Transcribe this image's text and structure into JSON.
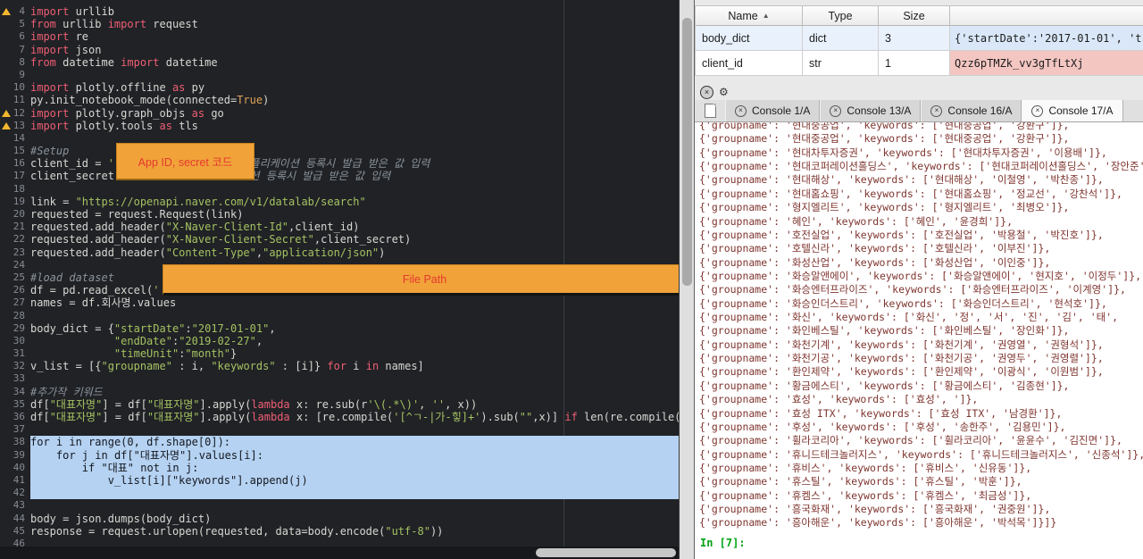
{
  "editor": {
    "annotations": [
      {
        "label": "App ID, secret 코드"
      },
      {
        "label": "File Path"
      }
    ],
    "lines": [
      {
        "n": 4,
        "warn": true,
        "toks": [
          [
            "kw",
            "import"
          ],
          [
            "def",
            " urllib"
          ]
        ]
      },
      {
        "n": 5,
        "toks": [
          [
            "kw",
            "from"
          ],
          [
            "def",
            " urllib "
          ],
          [
            "kw",
            "import"
          ],
          [
            "def",
            " request"
          ]
        ]
      },
      {
        "n": 6,
        "toks": [
          [
            "kw",
            "import"
          ],
          [
            "def",
            " re"
          ]
        ]
      },
      {
        "n": 7,
        "toks": [
          [
            "kw",
            "import"
          ],
          [
            "def",
            " json"
          ]
        ]
      },
      {
        "n": 8,
        "toks": [
          [
            "kw",
            "from"
          ],
          [
            "def",
            " datetime "
          ],
          [
            "kw",
            "import"
          ],
          [
            "def",
            " datetime"
          ]
        ]
      },
      {
        "n": 9,
        "toks": []
      },
      {
        "n": 10,
        "toks": [
          [
            "kw",
            "import"
          ],
          [
            "def",
            " plotly.offline "
          ],
          [
            "kw",
            "as"
          ],
          [
            "def",
            " py"
          ]
        ]
      },
      {
        "n": 11,
        "toks": [
          [
            "def",
            "py.init_notebook_mode(connected="
          ],
          [
            "num",
            "True"
          ],
          [
            "def",
            ")"
          ]
        ]
      },
      {
        "n": 12,
        "warn": true,
        "toks": [
          [
            "kw",
            "import"
          ],
          [
            "def",
            " plotly.graph_objs "
          ],
          [
            "kw",
            "as"
          ],
          [
            "def",
            " go"
          ]
        ]
      },
      {
        "n": 13,
        "warn": true,
        "toks": [
          [
            "kw",
            "import"
          ],
          [
            "def",
            " plotly.tools "
          ],
          [
            "kw",
            "as"
          ],
          [
            "def",
            " tls"
          ]
        ]
      },
      {
        "n": 14,
        "toks": []
      },
      {
        "n": 15,
        "toks": [
          [
            "com",
            "#Setup"
          ]
        ]
      },
      {
        "n": 16,
        "toks": [
          [
            "def",
            "client_id = "
          ],
          [
            "str",
            "'"
          ],
          [
            "def",
            "                     "
          ],
          [
            "com",
            "플리케이션 등록시 발급 받은 값 입력"
          ]
        ]
      },
      {
        "n": 17,
        "toks": [
          [
            "def",
            "client_secret"
          ],
          [
            "def",
            "                     "
          ],
          [
            "com",
            "션 등록시 발급 받은 값 입력"
          ]
        ]
      },
      {
        "n": 18,
        "toks": []
      },
      {
        "n": 19,
        "toks": [
          [
            "def",
            "link = "
          ],
          [
            "str",
            "\"https://openapi.naver.com/v1/datalab/search\""
          ]
        ]
      },
      {
        "n": 20,
        "toks": [
          [
            "def",
            "requested = request.Request(link)"
          ]
        ]
      },
      {
        "n": 21,
        "toks": [
          [
            "def",
            "requested.add_header("
          ],
          [
            "str",
            "\"X-Naver-Client-Id\""
          ],
          [
            "def",
            ",client_id)"
          ]
        ]
      },
      {
        "n": 22,
        "toks": [
          [
            "def",
            "requested.add_header("
          ],
          [
            "str",
            "\"X-Naver-Client-Secret\""
          ],
          [
            "def",
            ",client_secret)"
          ]
        ]
      },
      {
        "n": 23,
        "toks": [
          [
            "def",
            "requested.add_header("
          ],
          [
            "str",
            "\"Content-Type\""
          ],
          [
            "def",
            ","
          ],
          [
            "str",
            "\"application/json\""
          ],
          [
            "def",
            ")"
          ]
        ]
      },
      {
        "n": 24,
        "toks": []
      },
      {
        "n": 25,
        "toks": [
          [
            "com",
            "#load dataset"
          ]
        ]
      },
      {
        "n": 26,
        "toks": [
          [
            "def",
            "df = pd.read_excel("
          ],
          [
            "str",
            "'"
          ]
        ]
      },
      {
        "n": 27,
        "toks": [
          [
            "def",
            "names = df.회사명.values"
          ]
        ]
      },
      {
        "n": 28,
        "toks": []
      },
      {
        "n": 29,
        "toks": [
          [
            "def",
            "body_dict = {"
          ],
          [
            "str",
            "\"startDate\""
          ],
          [
            "def",
            ":"
          ],
          [
            "str",
            "\"2017-01-01\""
          ],
          [
            "def",
            ","
          ]
        ]
      },
      {
        "n": 30,
        "toks": [
          [
            "def",
            "             "
          ],
          [
            "str",
            "\"endDate\""
          ],
          [
            "def",
            ":"
          ],
          [
            "str",
            "\"2019-02-27\""
          ],
          [
            "def",
            ","
          ]
        ]
      },
      {
        "n": 31,
        "toks": [
          [
            "def",
            "             "
          ],
          [
            "str",
            "\"timeUnit\""
          ],
          [
            "def",
            ":"
          ],
          [
            "str",
            "\"month\""
          ],
          [
            "def",
            "}"
          ]
        ]
      },
      {
        "n": 32,
        "toks": [
          [
            "def",
            "v_list = [{"
          ],
          [
            "str",
            "\"groupname\""
          ],
          [
            "def",
            " : i, "
          ],
          [
            "str",
            "\"keywords\""
          ],
          [
            "def",
            " : [i]} "
          ],
          [
            "kw",
            "for"
          ],
          [
            "def",
            " i "
          ],
          [
            "kw",
            "in"
          ],
          [
            "def",
            " names]"
          ]
        ]
      },
      {
        "n": 33,
        "toks": []
      },
      {
        "n": 34,
        "toks": [
          [
            "com",
            "#추가작 키워드"
          ]
        ]
      },
      {
        "n": 35,
        "toks": [
          [
            "def",
            "df["
          ],
          [
            "str",
            "\"대표자명\""
          ],
          [
            "def",
            "] = df["
          ],
          [
            "str",
            "\"대표자명\""
          ],
          [
            "def",
            "].apply("
          ],
          [
            "kw",
            "lambda"
          ],
          [
            "def",
            " x: re.sub(r"
          ],
          [
            "str",
            "'\\(.*\\)'"
          ],
          [
            "def",
            ", "
          ],
          [
            "str",
            "''"
          ],
          [
            "def",
            ", x))"
          ]
        ]
      },
      {
        "n": 36,
        "toks": [
          [
            "def",
            "df["
          ],
          [
            "str",
            "\"대표자명\""
          ],
          [
            "def",
            "] = df["
          ],
          [
            "str",
            "\"대표자명\""
          ],
          [
            "def",
            "].apply("
          ],
          [
            "kw",
            "lambda"
          ],
          [
            "def",
            " x: [re.compile("
          ],
          [
            "str",
            "'[^ㄱ-|가-힣]+'"
          ],
          [
            "def",
            ").sub("
          ],
          [
            "str",
            "\"\""
          ],
          [
            "def",
            ",x)] "
          ],
          [
            "kw",
            "if"
          ],
          [
            "def",
            " len(re.compile("
          ]
        ]
      },
      {
        "n": 37,
        "toks": []
      },
      {
        "n": 38,
        "sel": true,
        "toks": [
          [
            "kw",
            "for"
          ],
          [
            "def",
            " i "
          ],
          [
            "kw",
            "in"
          ],
          [
            "def",
            " range("
          ],
          [
            "num",
            "0"
          ],
          [
            "def",
            ", df.shape["
          ],
          [
            "num",
            "0"
          ],
          [
            "def",
            "]):"
          ]
        ]
      },
      {
        "n": 39,
        "sel": true,
        "toks": [
          [
            "def",
            "    "
          ],
          [
            "kw",
            "for"
          ],
          [
            "def",
            " j "
          ],
          [
            "kw",
            "in"
          ],
          [
            "def",
            " df["
          ],
          [
            "str",
            "\"대표자명\""
          ],
          [
            "def",
            "].values[i]:"
          ]
        ]
      },
      {
        "n": 40,
        "sel": true,
        "toks": [
          [
            "def",
            "        "
          ],
          [
            "kw",
            "if"
          ],
          [
            "def",
            " "
          ],
          [
            "str",
            "\"대표\""
          ],
          [
            "def",
            " "
          ],
          [
            "kw",
            "not"
          ],
          [
            "def",
            " "
          ],
          [
            "kw",
            "in"
          ],
          [
            "def",
            " j:"
          ]
        ]
      },
      {
        "n": 41,
        "sel": true,
        "toks": [
          [
            "def",
            "            v_list[i]["
          ],
          [
            "str",
            "\"keywords\""
          ],
          [
            "def",
            "].append(j)"
          ]
        ]
      },
      {
        "n": 42,
        "sel": true,
        "toks": []
      },
      {
        "n": 43,
        "toks": []
      },
      {
        "n": 44,
        "toks": [
          [
            "def",
            "body = json.dumps(body_dict)"
          ]
        ]
      },
      {
        "n": 45,
        "toks": [
          [
            "def",
            "response = request.urlopen(requested, data=body.encode("
          ],
          [
            "str",
            "\"utf-8\""
          ],
          [
            "def",
            "))"
          ]
        ]
      },
      {
        "n": 46,
        "toks": []
      }
    ]
  },
  "variable_explorer": {
    "columns": [
      {
        "label": "Name"
      },
      {
        "label": "Type"
      },
      {
        "label": "Size"
      }
    ],
    "sort_glyph": "▲",
    "rows": [
      {
        "name": "body_dict",
        "type": "dict",
        "size": "3",
        "value": "{'startDate':'2017-01-01', 't",
        "kind": "dict",
        "selected": true
      },
      {
        "name": "client_id",
        "type": "str",
        "size": "1",
        "value": "Qzz6pTMZk_vv3gTfLtXj",
        "kind": "str",
        "selected": false
      }
    ]
  },
  "console": {
    "controls": [
      {
        "name": "close",
        "glyph": "×"
      },
      {
        "name": "options",
        "glyph": "⚙"
      }
    ],
    "close_glyph": "×",
    "tabs": [
      {
        "label": "Console 1/A",
        "active": false
      },
      {
        "label": "Console 13/A",
        "active": false
      },
      {
        "label": "Console 16/A",
        "active": false
      },
      {
        "label": "Console 17/A",
        "active": true
      }
    ],
    "output_lines": [
      "{'groupname': '현대중공업', 'keywords': ['현대중공업', '강환구']},",
      "{'groupname': '현대중공업', 'keywords': ['현대중공업', '강환구']},",
      "{'groupname': '현대차투자증권', 'keywords': ['현대차투자증권', '이용배']},",
      "{'groupname': '현대코퍼레이션홀딩스', 'keywords': ['현대코퍼레이션홀딩스', '장안준']},",
      "{'groupname': '현대해상', 'keywords': ['현대해상', '이철영', '박찬종']},",
      "{'groupname': '현대홈쇼핑', 'keywords': ['현대홈쇼핑', '정교선', '강찬석']},",
      "{'groupname': '형지엘리트', 'keywords': ['형지엘리트', '최병오']},",
      "{'groupname': '혜인', 'keywords': ['혜인', '윤경희']},",
      "{'groupname': '호전실업', 'keywords': ['호전실업', '박용철', '박진호']},",
      "{'groupname': '호텔신라', 'keywords': ['호텔신라', '이부진']},",
      "{'groupname': '화성산업', 'keywords': ['화성산업', '이인중']},",
      "{'groupname': '화승알앤에이', 'keywords': ['화승알앤에이', '현지호', '이정두']},",
      "{'groupname': '화승엔터프라이즈', 'keywords': ['화승엔터프라이즈', '이계영']},",
      "{'groupname': '화승인더스트리', 'keywords': ['화승인더스트리', '현석호']},",
      "{'groupname': '화신', 'keywords': ['화신', '정', '서', '진', '김', '태',",
      "{'groupname': '화인베스틸', 'keywords': ['화인베스틸', '장인화']},",
      "{'groupname': '화천기계', 'keywords': ['화천기계', '권영열', '권형석']},",
      "{'groupname': '화천기공', 'keywords': ['화천기공', '권영두', '권영렬']},",
      "{'groupname': '환인제약', 'keywords': ['환인제약', '이광식', '이원범']},",
      "{'groupname': '황금에스티', 'keywords': ['황금에스티', '김종현']},",
      "{'groupname': '효성', 'keywords': ['효성', ']},",
      "{'groupname': '효성 ITX', 'keywords': ['효성 ITX', '남경환']},",
      "{'groupname': '후성', 'keywords': ['후성', '송한주', '김용민']},",
      "{'groupname': '휠라코리아', 'keywords': ['휠라코리아', '윤윤수', '김진면']},",
      "{'groupname': '휴니드테크놀러지스', 'keywords': ['휴니드테크놀러지스', '신종석']},",
      "{'groupname': '휴비스', 'keywords': ['휴비스', '신유동']},",
      "{'groupname': '휴스틸', 'keywords': ['휴스틸', '박훈']},",
      "{'groupname': '휴켐스', 'keywords': ['휴켐스', '최금성']},",
      "{'groupname': '흥국화재', 'keywords': ['흥국화재', '권중원']},",
      "{'groupname': '흥아해운', 'keywords': ['흥아해운', '박석목']}]}"
    ],
    "prompt": "In [7]:"
  },
  "colors": {
    "editor_bg": "#202226",
    "selection": "#b5d2f2",
    "keyword": "#ef5e73",
    "string": "#a5c261",
    "comment": "#8a939b",
    "annotation_bg": "#f1a33a",
    "annotation_text": "#e4392e",
    "console_output": "#7f352f",
    "prompt_green": "#00a314",
    "str_value_bg": "#f3c6c2",
    "dict_value_bg": "#d9e7f8"
  }
}
